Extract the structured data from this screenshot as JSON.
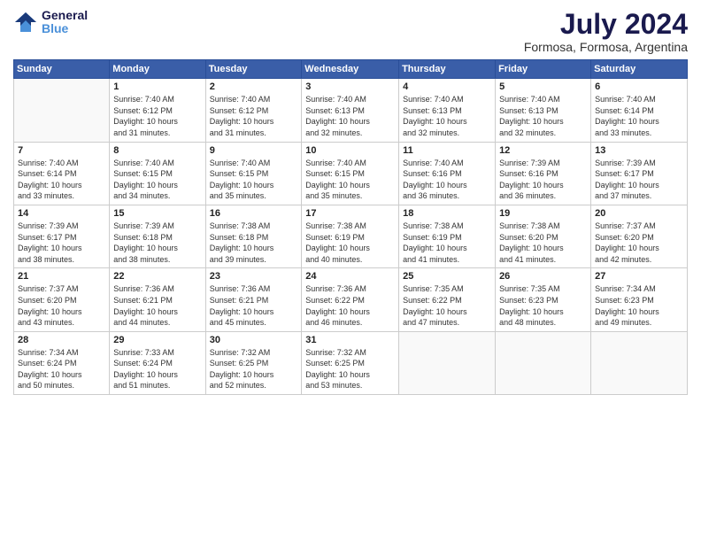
{
  "logo": {
    "line1": "General",
    "line2": "Blue"
  },
  "title": "July 2024",
  "subtitle": "Formosa, Formosa, Argentina",
  "days_header": [
    "Sunday",
    "Monday",
    "Tuesday",
    "Wednesday",
    "Thursday",
    "Friday",
    "Saturday"
  ],
  "weeks": [
    [
      {
        "num": "",
        "info": ""
      },
      {
        "num": "1",
        "info": "Sunrise: 7:40 AM\nSunset: 6:12 PM\nDaylight: 10 hours\nand 31 minutes."
      },
      {
        "num": "2",
        "info": "Sunrise: 7:40 AM\nSunset: 6:12 PM\nDaylight: 10 hours\nand 31 minutes."
      },
      {
        "num": "3",
        "info": "Sunrise: 7:40 AM\nSunset: 6:13 PM\nDaylight: 10 hours\nand 32 minutes."
      },
      {
        "num": "4",
        "info": "Sunrise: 7:40 AM\nSunset: 6:13 PM\nDaylight: 10 hours\nand 32 minutes."
      },
      {
        "num": "5",
        "info": "Sunrise: 7:40 AM\nSunset: 6:13 PM\nDaylight: 10 hours\nand 32 minutes."
      },
      {
        "num": "6",
        "info": "Sunrise: 7:40 AM\nSunset: 6:14 PM\nDaylight: 10 hours\nand 33 minutes."
      }
    ],
    [
      {
        "num": "7",
        "info": "Sunrise: 7:40 AM\nSunset: 6:14 PM\nDaylight: 10 hours\nand 33 minutes."
      },
      {
        "num": "8",
        "info": "Sunrise: 7:40 AM\nSunset: 6:15 PM\nDaylight: 10 hours\nand 34 minutes."
      },
      {
        "num": "9",
        "info": "Sunrise: 7:40 AM\nSunset: 6:15 PM\nDaylight: 10 hours\nand 35 minutes."
      },
      {
        "num": "10",
        "info": "Sunrise: 7:40 AM\nSunset: 6:15 PM\nDaylight: 10 hours\nand 35 minutes."
      },
      {
        "num": "11",
        "info": "Sunrise: 7:40 AM\nSunset: 6:16 PM\nDaylight: 10 hours\nand 36 minutes."
      },
      {
        "num": "12",
        "info": "Sunrise: 7:39 AM\nSunset: 6:16 PM\nDaylight: 10 hours\nand 36 minutes."
      },
      {
        "num": "13",
        "info": "Sunrise: 7:39 AM\nSunset: 6:17 PM\nDaylight: 10 hours\nand 37 minutes."
      }
    ],
    [
      {
        "num": "14",
        "info": "Sunrise: 7:39 AM\nSunset: 6:17 PM\nDaylight: 10 hours\nand 38 minutes."
      },
      {
        "num": "15",
        "info": "Sunrise: 7:39 AM\nSunset: 6:18 PM\nDaylight: 10 hours\nand 38 minutes."
      },
      {
        "num": "16",
        "info": "Sunrise: 7:38 AM\nSunset: 6:18 PM\nDaylight: 10 hours\nand 39 minutes."
      },
      {
        "num": "17",
        "info": "Sunrise: 7:38 AM\nSunset: 6:19 PM\nDaylight: 10 hours\nand 40 minutes."
      },
      {
        "num": "18",
        "info": "Sunrise: 7:38 AM\nSunset: 6:19 PM\nDaylight: 10 hours\nand 41 minutes."
      },
      {
        "num": "19",
        "info": "Sunrise: 7:38 AM\nSunset: 6:20 PM\nDaylight: 10 hours\nand 41 minutes."
      },
      {
        "num": "20",
        "info": "Sunrise: 7:37 AM\nSunset: 6:20 PM\nDaylight: 10 hours\nand 42 minutes."
      }
    ],
    [
      {
        "num": "21",
        "info": "Sunrise: 7:37 AM\nSunset: 6:20 PM\nDaylight: 10 hours\nand 43 minutes."
      },
      {
        "num": "22",
        "info": "Sunrise: 7:36 AM\nSunset: 6:21 PM\nDaylight: 10 hours\nand 44 minutes."
      },
      {
        "num": "23",
        "info": "Sunrise: 7:36 AM\nSunset: 6:21 PM\nDaylight: 10 hours\nand 45 minutes."
      },
      {
        "num": "24",
        "info": "Sunrise: 7:36 AM\nSunset: 6:22 PM\nDaylight: 10 hours\nand 46 minutes."
      },
      {
        "num": "25",
        "info": "Sunrise: 7:35 AM\nSunset: 6:22 PM\nDaylight: 10 hours\nand 47 minutes."
      },
      {
        "num": "26",
        "info": "Sunrise: 7:35 AM\nSunset: 6:23 PM\nDaylight: 10 hours\nand 48 minutes."
      },
      {
        "num": "27",
        "info": "Sunrise: 7:34 AM\nSunset: 6:23 PM\nDaylight: 10 hours\nand 49 minutes."
      }
    ],
    [
      {
        "num": "28",
        "info": "Sunrise: 7:34 AM\nSunset: 6:24 PM\nDaylight: 10 hours\nand 50 minutes."
      },
      {
        "num": "29",
        "info": "Sunrise: 7:33 AM\nSunset: 6:24 PM\nDaylight: 10 hours\nand 51 minutes."
      },
      {
        "num": "30",
        "info": "Sunrise: 7:32 AM\nSunset: 6:25 PM\nDaylight: 10 hours\nand 52 minutes."
      },
      {
        "num": "31",
        "info": "Sunrise: 7:32 AM\nSunset: 6:25 PM\nDaylight: 10 hours\nand 53 minutes."
      },
      {
        "num": "",
        "info": ""
      },
      {
        "num": "",
        "info": ""
      },
      {
        "num": "",
        "info": ""
      }
    ]
  ]
}
